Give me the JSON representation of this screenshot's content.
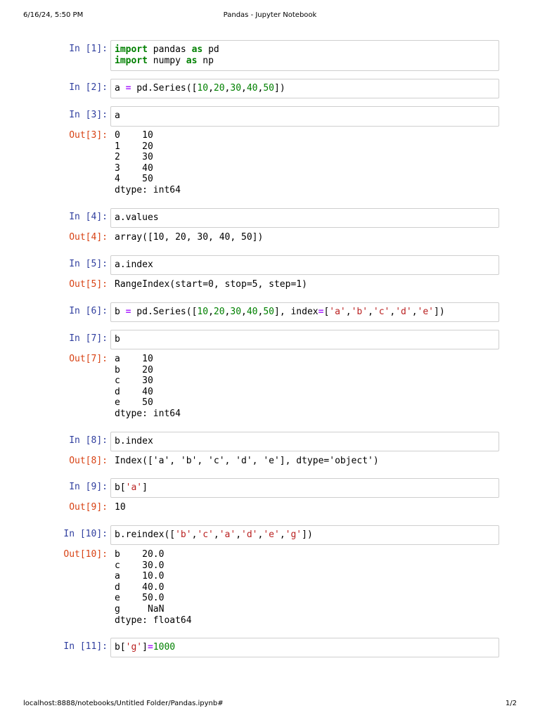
{
  "header": {
    "datetime": "6/16/24, 5:50 PM",
    "title": "Pandas - Jupyter Notebook"
  },
  "footer": {
    "url": "localhost:8888/notebooks/Untitled Folder/Pandas.ipynb#",
    "page": "1/2"
  },
  "colors": {
    "in_prompt": "#303f9f",
    "out_prompt": "#d84315",
    "keyword": "#008000",
    "operator": "#aa22ff",
    "number": "#008000",
    "string": "#ba2121",
    "cell_border": "#cfcfcf"
  },
  "cells": [
    {
      "in": "In [1]:",
      "code": [
        [
          {
            "t": "kw",
            "v": "import"
          },
          {
            "t": "p",
            "v": " pandas "
          },
          {
            "t": "kw",
            "v": "as"
          },
          {
            "t": "p",
            "v": " pd"
          }
        ],
        [
          {
            "t": "kw",
            "v": "import"
          },
          {
            "t": "p",
            "v": " numpy "
          },
          {
            "t": "kw",
            "v": "as"
          },
          {
            "t": "p",
            "v": " np"
          }
        ]
      ]
    },
    {
      "in": "In [2]:",
      "code": [
        [
          {
            "t": "p",
            "v": "a "
          },
          {
            "t": "op",
            "v": "="
          },
          {
            "t": "p",
            "v": " pd.Series(["
          },
          {
            "t": "num",
            "v": "10"
          },
          {
            "t": "p",
            "v": ","
          },
          {
            "t": "num",
            "v": "20"
          },
          {
            "t": "p",
            "v": ","
          },
          {
            "t": "num",
            "v": "30"
          },
          {
            "t": "p",
            "v": ","
          },
          {
            "t": "num",
            "v": "40"
          },
          {
            "t": "p",
            "v": ","
          },
          {
            "t": "num",
            "v": "50"
          },
          {
            "t": "p",
            "v": "])"
          }
        ]
      ]
    },
    {
      "in": "In [3]:",
      "code": [
        [
          {
            "t": "p",
            "v": "a"
          }
        ]
      ],
      "out": "Out[3]:",
      "output": "0    10\n1    20\n2    30\n3    40\n4    50\ndtype: int64"
    },
    {
      "in": "In [4]:",
      "code": [
        [
          {
            "t": "p",
            "v": "a.values"
          }
        ]
      ],
      "out": "Out[4]:",
      "output": "array([10, 20, 30, 40, 50])"
    },
    {
      "in": "In [5]:",
      "code": [
        [
          {
            "t": "p",
            "v": "a.index"
          }
        ]
      ],
      "out": "Out[5]:",
      "output": "RangeIndex(start=0, stop=5, step=1)"
    },
    {
      "in": "In [6]:",
      "code": [
        [
          {
            "t": "p",
            "v": "b "
          },
          {
            "t": "op",
            "v": "="
          },
          {
            "t": "p",
            "v": " pd.Series(["
          },
          {
            "t": "num",
            "v": "10"
          },
          {
            "t": "p",
            "v": ","
          },
          {
            "t": "num",
            "v": "20"
          },
          {
            "t": "p",
            "v": ","
          },
          {
            "t": "num",
            "v": "30"
          },
          {
            "t": "p",
            "v": ","
          },
          {
            "t": "num",
            "v": "40"
          },
          {
            "t": "p",
            "v": ","
          },
          {
            "t": "num",
            "v": "50"
          },
          {
            "t": "p",
            "v": "], index"
          },
          {
            "t": "op",
            "v": "="
          },
          {
            "t": "p",
            "v": "["
          },
          {
            "t": "str",
            "v": "'a'"
          },
          {
            "t": "p",
            "v": ","
          },
          {
            "t": "str",
            "v": "'b'"
          },
          {
            "t": "p",
            "v": ","
          },
          {
            "t": "str",
            "v": "'c'"
          },
          {
            "t": "p",
            "v": ","
          },
          {
            "t": "str",
            "v": "'d'"
          },
          {
            "t": "p",
            "v": ","
          },
          {
            "t": "str",
            "v": "'e'"
          },
          {
            "t": "p",
            "v": "])"
          }
        ]
      ]
    },
    {
      "in": "In [7]:",
      "code": [
        [
          {
            "t": "p",
            "v": "b"
          }
        ]
      ],
      "out": "Out[7]:",
      "output": "a    10\nb    20\nc    30\nd    40\ne    50\ndtype: int64"
    },
    {
      "in": "In [8]:",
      "code": [
        [
          {
            "t": "p",
            "v": "b.index"
          }
        ]
      ],
      "out": "Out[8]:",
      "output": "Index(['a', 'b', 'c', 'd', 'e'], dtype='object')"
    },
    {
      "in": "In [9]:",
      "code": [
        [
          {
            "t": "p",
            "v": "b["
          },
          {
            "t": "str",
            "v": "'a'"
          },
          {
            "t": "p",
            "v": "]"
          }
        ]
      ],
      "out": "Out[9]:",
      "output": "10"
    },
    {
      "in": "In [10]:",
      "code": [
        [
          {
            "t": "p",
            "v": "b.reindex(["
          },
          {
            "t": "str",
            "v": "'b'"
          },
          {
            "t": "p",
            "v": ","
          },
          {
            "t": "str",
            "v": "'c'"
          },
          {
            "t": "p",
            "v": ","
          },
          {
            "t": "str",
            "v": "'a'"
          },
          {
            "t": "p",
            "v": ","
          },
          {
            "t": "str",
            "v": "'d'"
          },
          {
            "t": "p",
            "v": ","
          },
          {
            "t": "str",
            "v": "'e'"
          },
          {
            "t": "p",
            "v": ","
          },
          {
            "t": "str",
            "v": "'g'"
          },
          {
            "t": "p",
            "v": "])"
          }
        ]
      ],
      "out": "Out[10]:",
      "output": "b    20.0\nc    30.0\na    10.0\nd    40.0\ne    50.0\ng     NaN\ndtype: float64"
    },
    {
      "in": "In [11]:",
      "code": [
        [
          {
            "t": "p",
            "v": "b["
          },
          {
            "t": "str",
            "v": "'g'"
          },
          {
            "t": "p",
            "v": "]"
          },
          {
            "t": "op",
            "v": "="
          },
          {
            "t": "num",
            "v": "1000"
          }
        ]
      ]
    }
  ]
}
